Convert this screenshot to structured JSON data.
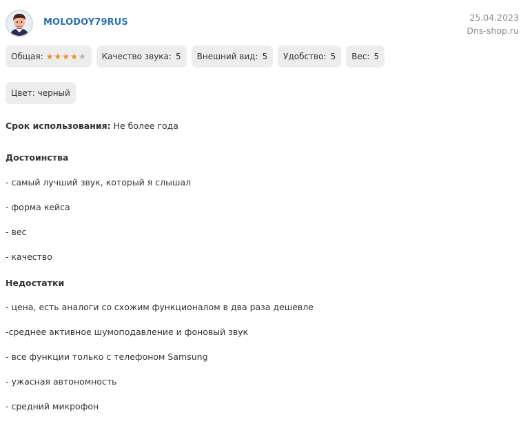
{
  "review": {
    "author": "MOLODOY79RUS",
    "date": "25.04.2023",
    "source": "Dns-shop.ru"
  },
  "ratings": {
    "overall_label": "Общая:",
    "overall_stars": 4,
    "overall_max": 5,
    "items": [
      {
        "label": "Качество звука:",
        "value": "5"
      },
      {
        "label": "Внешний вид:",
        "value": "5"
      },
      {
        "label": "Удобство:",
        "value": "5"
      },
      {
        "label": "Вес:",
        "value": "5"
      }
    ]
  },
  "color": {
    "text": "Цвет: черный"
  },
  "usage": {
    "label": "Срок использования:",
    "value": "Не более года"
  },
  "pros": {
    "title": "Достоинства",
    "items": [
      "- самый лучший звук, который я слышал",
      "- форма кейса",
      "- вес",
      "- качество"
    ]
  },
  "cons": {
    "title": "Недостатки",
    "items": [
      "- цена, есть аналоги со схожим функционалом в два раза дешевле",
      "-среднее активное шумоподавление и фоновый звук",
      "- все функции только с телефоном Samsung",
      "- ужасная автономность",
      "- средний микрофон"
    ]
  },
  "colors": {
    "accent": "#2a6fb5",
    "star": "#f28c1b",
    "chip_bg": "#ededed"
  }
}
